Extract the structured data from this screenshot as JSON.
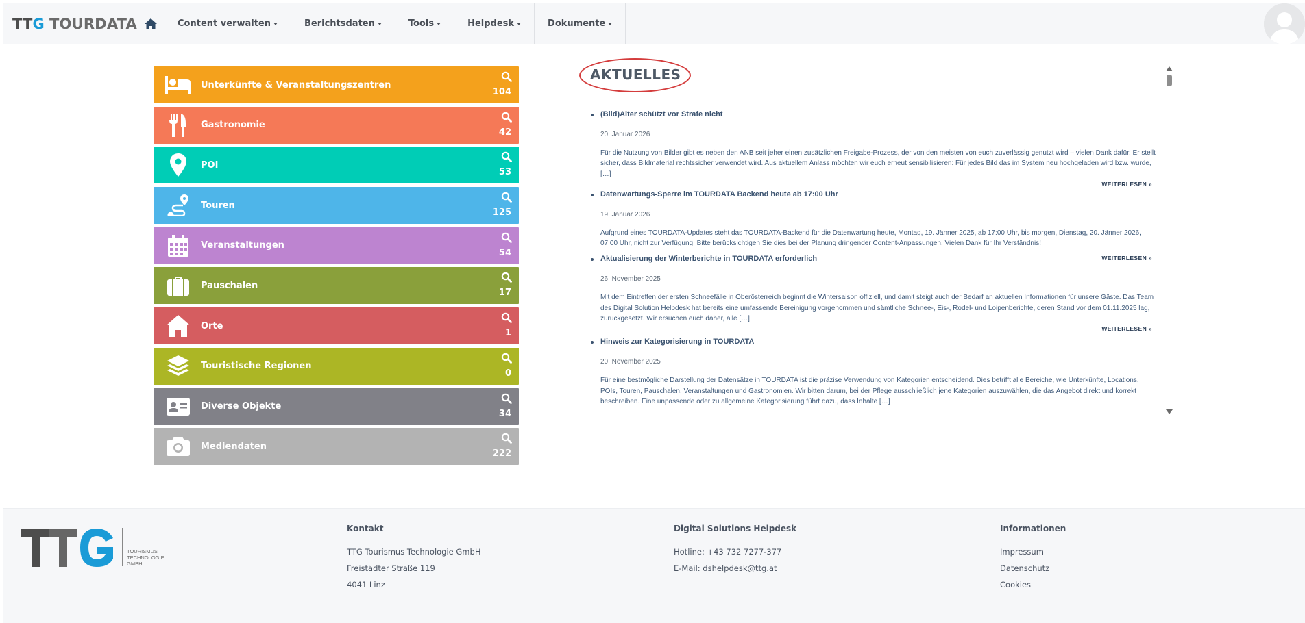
{
  "nav": {
    "brand_prefix": "TT",
    "brand_g": "G",
    "brand_name": "TOURDATA",
    "menu": [
      {
        "label": "Content verwalten"
      },
      {
        "label": "Berichtsdaten"
      },
      {
        "label": "Tools"
      },
      {
        "label": "Helpdesk"
      },
      {
        "label": "Dokumente"
      }
    ]
  },
  "categories": [
    {
      "label": "Unterkünfte & Veranstaltungszentren",
      "count": "104",
      "color": "#f4a11c",
      "icon": "bed-icon"
    },
    {
      "label": "Gastronomie",
      "count": "42",
      "color": "#f57957",
      "icon": "fork-knife-icon"
    },
    {
      "label": "POI",
      "count": "53",
      "color": "#00cdb6",
      "icon": "map-pin-icon"
    },
    {
      "label": "Touren",
      "count": "125",
      "color": "#4eb5e9",
      "icon": "route-icon"
    },
    {
      "label": "Veranstaltungen",
      "count": "54",
      "color": "#bd84d0",
      "icon": "calendar-icon"
    },
    {
      "label": "Pauschalen",
      "count": "17",
      "color": "#8aa03b",
      "icon": "suitcase-icon"
    },
    {
      "label": "Orte",
      "count": "1",
      "color": "#d55d60",
      "icon": "house-icon"
    },
    {
      "label": "Touristische Regionen",
      "count": "0",
      "color": "#acb625",
      "icon": "layers-icon"
    },
    {
      "label": "Diverse Objekte",
      "count": "34",
      "color": "#818188",
      "icon": "id-card-icon"
    },
    {
      "label": "Mediendaten",
      "count": "222",
      "color": "#b3b3b3",
      "icon": "camera-icon"
    }
  ],
  "news": {
    "title": "AKTUELLES",
    "read_more": "WEITERLESEN »",
    "articles": [
      {
        "title": "(Bild)Alter schützt vor Strafe nicht",
        "date": "20. Januar 2026",
        "text": "Für die Nutzung von Bilder gibt es neben den ANB seit jeher einen zusätzlichen Freigabe-Prozess, der von den meisten von euch zuverlässig genutzt wird – vielen Dank dafür. Er stellt sicher, dass Bildmaterial rechtssicher verwendet wird. Aus aktuellem Anlass möchten wir euch erneut sensibilisieren: Für jedes Bild das im System neu hochgeladen wird bzw. wurde, […]"
      },
      {
        "title": "Datenwartungs-Sperre im TOURDATA Backend heute ab 17:00 Uhr",
        "date": "19. Januar 2026",
        "text": "Aufgrund eines TOURDATA-Updates steht das TOURDATA-Backend für die Datenwartung heute, Montag, 19. Jänner 2025, ab 17:00 Uhr, bis morgen, Dienstag, 20. Jänner 2026, 07:00 Uhr, nicht zur Verfügung. Bitte berücksichtigen Sie dies bei der Planung dringender Content-Anpassungen. Vielen Dank für Ihr Verständnis!"
      },
      {
        "title": "Aktualisierung der Winterberichte in TOURDATA erforderlich",
        "date": "26. November 2025",
        "text": "Mit dem Eintreffen der ersten Schneefälle in Oberösterreich beginnt die Wintersaison offiziell, und damit steigt auch der Bedarf an aktuellen Informationen für unsere Gäste. Das Team des Digital Solution Helpdesk hat bereits eine umfassende Bereinigung vorgenommen und sämtliche Schnee-, Eis-, Rodel- und Loipenberichte, deren Stand vor dem 01.11.2025 lag, zurückgesetzt. Wir ersuchen euch daher, alle […]"
      },
      {
        "title": "Hinweis zur Kategorisierung in TOURDATA",
        "date": "20. November 2025",
        "text": "Für eine bestmögliche Darstellung der Datensätze in TOURDATA ist die präzise Verwendung von Kategorien entscheidend. Dies betrifft alle Bereiche, wie Unterkünfte, Locations, POIs, Touren, Pauschalen, Veranstaltungen und Gastronomien. Wir bitten darum, bei der Pflege ausschließlich jene Kategorien auszuwählen, die das Angebot direkt und korrekt beschreiben. Eine unpassende oder zu allgemeine Kategorisierung führt dazu, dass Inhalte […]"
      }
    ]
  },
  "footer": {
    "logo_text": "TTG",
    "logo_tagline": [
      "TOURISMUS",
      "TECHNOLOGIE",
      "GMBH"
    ],
    "kontakt": {
      "heading": "Kontakt",
      "lines": [
        "TTG Tourismus Technologie GmbH",
        "Freistädter Straße 119",
        "4041 Linz"
      ]
    },
    "helpdesk": {
      "heading": "Digital Solutions Helpdesk",
      "lines": [
        "Hotline: +43 732 7277-377",
        "E-Mail: dshelpdesk@ttg.at"
      ]
    },
    "info": {
      "heading": "Informationen",
      "links": [
        "Impressum",
        "Datenschutz",
        "Cookies"
      ]
    }
  }
}
